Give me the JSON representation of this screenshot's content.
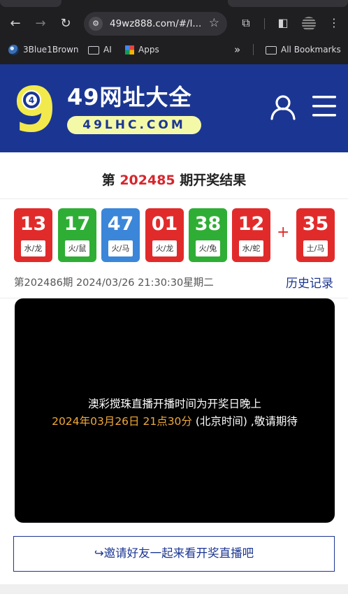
{
  "browser": {
    "url": "49wz888.com/#/l...",
    "bookmarks": [
      "3Blue1Brown",
      "AI",
      "Apps"
    ],
    "all_bookmarks": "All Bookmarks",
    "overflow": "»"
  },
  "site": {
    "logo_number": "9",
    "logo_ball": "4",
    "title": "49网址大全",
    "domain": "49LHC.COM"
  },
  "result": {
    "prefix": "第",
    "period": "202485",
    "suffix": "期开奖结果",
    "balls": [
      {
        "number": "13",
        "tag": "水/龙",
        "color": "#e12b2b"
      },
      {
        "number": "17",
        "tag": "火/鼠",
        "color": "#2fae35"
      },
      {
        "number": "47",
        "tag": "火/马",
        "color": "#3b86d9"
      },
      {
        "number": "01",
        "tag": "火/龙",
        "color": "#e12b2b"
      },
      {
        "number": "38",
        "tag": "火/兔",
        "color": "#2fae35"
      },
      {
        "number": "12",
        "tag": "水/蛇",
        "color": "#e12b2b"
      }
    ],
    "plus": "+",
    "special": {
      "number": "35",
      "tag": "土/马",
      "color": "#e12b2b"
    },
    "next_draw": "第202486期 2024/03/26 21:30:30星期二",
    "history_link": "历史记录"
  },
  "live": {
    "line1": "澳彩搅珠直播开播时间为开奖日晚上",
    "line2_highlight": "2024年03月26日 21点30分",
    "line2_rest": " (北京时间) ,敬请期待"
  },
  "invite": {
    "icon": "↪",
    "label": "邀请好友一起来看开奖直播吧"
  }
}
